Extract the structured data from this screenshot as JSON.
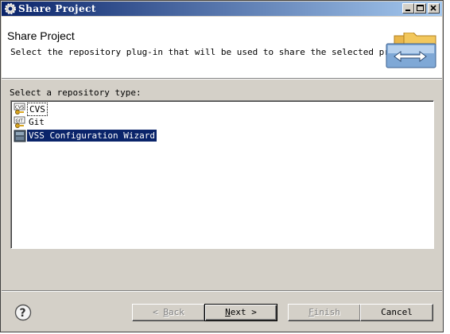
{
  "window": {
    "title": "Share Project"
  },
  "banner": {
    "title": "Share Project",
    "description": "Select the repository plug-in that will be used to share the selected project."
  },
  "repository": {
    "label": "Select a repository type:",
    "items": [
      {
        "label": "CVS",
        "icon": "cvs-icon",
        "state": "focused"
      },
      {
        "label": "Git",
        "icon": "git-icon",
        "state": "normal"
      },
      {
        "label": "VSS Configuration Wizard",
        "icon": "vss-icon",
        "state": "selected"
      }
    ]
  },
  "buttons": {
    "back": {
      "prefix": "< ",
      "mnemonic": "B",
      "rest": "ack",
      "enabled": false
    },
    "next": {
      "mnemonic": "N",
      "rest": "ext >",
      "enabled": true
    },
    "finish": {
      "mnemonic": "F",
      "rest": "inish",
      "enabled": false
    },
    "cancel": {
      "label": "Cancel",
      "enabled": true
    }
  },
  "colors": {
    "selection": "#0a246a",
    "face": "#d4d0c8"
  }
}
